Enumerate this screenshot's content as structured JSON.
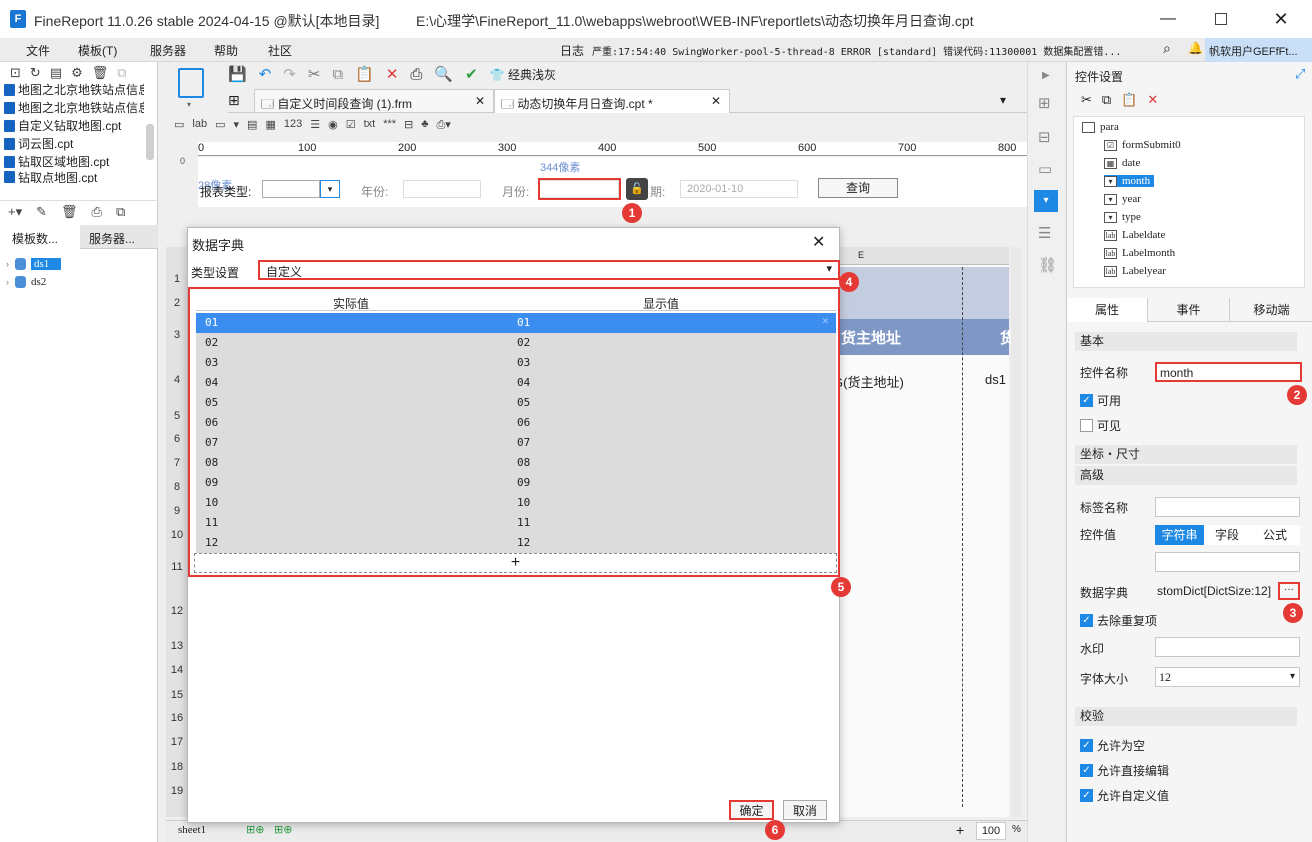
{
  "window": {
    "app": "FineReport 11.0.26 stable 2024-04-15 @默认[本地目录]",
    "path": "E:\\心理学\\FineReport_11.0\\webapps\\webroot\\WEB-INF\\reportlets\\动态切换年月日查询.cpt"
  },
  "menu": [
    "文件",
    "模板(T)",
    "服务器",
    "帮助",
    "社区"
  ],
  "log": {
    "label": "日志",
    "message": "严重:17:54:40 SwingWorker-pool-5-thread-8 ERROR [standard] 错误代码:11300001 数据集配置错...",
    "user": "帆软用户GEFfFt..."
  },
  "file_list": [
    "地图之北京地铁站点信息",
    "地图之北京地铁站点信息",
    "自定义钻取地图.cpt",
    "词云图.cpt",
    "钻取区域地图.cpt",
    "钻取点地图.cpt"
  ],
  "left_tabs": [
    "模板数...",
    "服务器..."
  ],
  "datasets": [
    "ds1",
    "ds2"
  ],
  "toolbar": {
    "theme_label": "经典浅灰",
    "tabs": [
      "自定义时间段查询 (1).frm",
      "动态切换年月日查询.cpt *"
    ]
  },
  "ruler": [
    "0",
    "100",
    "200",
    "300",
    "400",
    "500",
    "600",
    "700",
    "800"
  ],
  "param_pane": {
    "size_hint": "344像素",
    "size_hint2": "28像素",
    "type_label": "报表类型:",
    "year_label": "年份:",
    "month_label": "月份:",
    "date_label": "期:",
    "date_value": "2020-01-10",
    "query_label": "查询"
  },
  "grid": {
    "col_e": "E",
    "header_text": "货主地址",
    "header_text2": "货",
    "cell_text": "G(货主地址)",
    "cell_text2": "ds1",
    "row_numbers": [
      "1",
      "2",
      "3",
      "4",
      "5",
      "6",
      "7",
      "8",
      "9",
      "10",
      "11",
      "12",
      "13",
      "14",
      "15",
      "16",
      "17",
      "18",
      "19"
    ]
  },
  "sheet": {
    "name": "sheet1",
    "zoom": "100",
    "zoom_unit": "%"
  },
  "dialog": {
    "title": "数据字典",
    "type_label": "类型设置",
    "type_value": "自定义",
    "col_actual": "实际值",
    "col_display": "显示值",
    "rows": [
      [
        "01",
        "01"
      ],
      [
        "02",
        "02"
      ],
      [
        "03",
        "03"
      ],
      [
        "04",
        "04"
      ],
      [
        "05",
        "05"
      ],
      [
        "06",
        "06"
      ],
      [
        "07",
        "07"
      ],
      [
        "08",
        "08"
      ],
      [
        "09",
        "09"
      ],
      [
        "10",
        "10"
      ],
      [
        "11",
        "11"
      ],
      [
        "12",
        "12"
      ]
    ],
    "add": "+",
    "ok": "确定",
    "cancel": "取消"
  },
  "right_panel": {
    "title": "控件设置",
    "tree": [
      "para",
      "formSubmit0",
      "date",
      "month",
      "year",
      "type",
      "Labeldate",
      "Labelmonth",
      "Labelyear"
    ],
    "tabs": [
      "属性",
      "事件",
      "移动端"
    ],
    "basic": "基本",
    "name_label": "控件名称",
    "name_value": "month",
    "enabled": "可用",
    "visible": "可见",
    "coords": "坐标・尺寸",
    "advanced": "高级",
    "tag_name": "标签名称",
    "widget_value": "控件值",
    "value_tabs": [
      "字符串",
      "字段",
      "公式"
    ],
    "dict_label": "数据字典",
    "dict_value": "stomDict[DictSize:12]",
    "dict_btn": "···",
    "dedupe": "去除重复项",
    "watermark": "水印",
    "font_size": "字体大小",
    "font_size_value": "12",
    "validate": "校验",
    "allow_empty": "允许为空",
    "allow_edit": "允许直接编辑",
    "allow_custom": "允许自定义值"
  },
  "badges": [
    "1",
    "2",
    "3",
    "4",
    "5",
    "6"
  ],
  "colors": {
    "accent": "#1e88e5",
    "marker": "#e53935",
    "header_band": "#7f97c4"
  }
}
